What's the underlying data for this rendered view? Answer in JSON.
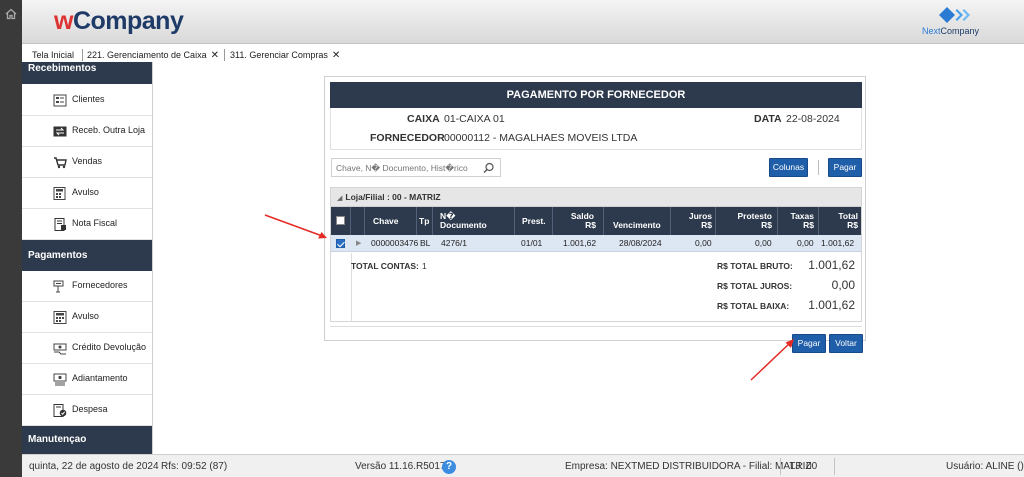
{
  "app": {
    "brand_w": "w",
    "brand_rest": "Company",
    "partner_prefix": "Next",
    "partner_suffix": "Company"
  },
  "tabs": [
    {
      "label": "Tela Inicial"
    },
    {
      "label": "221. Gerenciamento de Caixa"
    },
    {
      "label": "311. Gerenciar Compras"
    }
  ],
  "sidebar": {
    "sections": {
      "recebimentos": "Recebimentos",
      "pagamentos": "Pagamentos",
      "manutencao": "Manutençao"
    },
    "receb_items": [
      {
        "label": "Clientes",
        "icon": "users-list-icon"
      },
      {
        "label": "Receb. Outra Loja",
        "icon": "transfer-icon"
      },
      {
        "label": "Vendas",
        "icon": "cart-icon"
      },
      {
        "label": "Avulso",
        "icon": "calculator-icon"
      },
      {
        "label": "Nota Fiscal",
        "icon": "invoice-icon"
      }
    ],
    "pag_items": [
      {
        "label": "Fornecedores",
        "icon": "supplier-icon"
      },
      {
        "label": "Avulso",
        "icon": "calculator-icon"
      },
      {
        "label": "Crédito Devolução",
        "icon": "credit-icon"
      },
      {
        "label": "Adiantamento",
        "icon": "advance-icon"
      },
      {
        "label": "Despesa",
        "icon": "expense-icon"
      }
    ]
  },
  "panel": {
    "title": "PAGAMENTO POR FORNECEDOR",
    "caixa_label": "CAIXA",
    "caixa_value": "01-CAIXA 01",
    "data_label": "DATA",
    "data_value": "22-08-2024",
    "fornecedor_label": "FORNECEDOR",
    "fornecedor_value": "00000112 - MAGALHAES MOVEIS LTDA",
    "search_placeholder": "Chave, N� Documento, Hist�rico",
    "colunas_label": "Colunas",
    "pagar_top_label": "Pagar",
    "group_label": "Loja/Filial : 00 - MATRIZ",
    "columns": {
      "chave": "Chave",
      "tp": "Tp",
      "doc_1": "N�",
      "doc_2": "Documento",
      "prest": "Prest.",
      "saldo_1": "Saldo",
      "saldo_2": "R$",
      "venc": "Vencimento",
      "juros_1": "Juros",
      "juros_2": "R$",
      "protesto_1": "Protesto",
      "protesto_2": "R$",
      "taxas_1": "Taxas",
      "taxas_2": "R$",
      "total_1": "Total",
      "total_2": "R$"
    },
    "row": {
      "checked": true,
      "chave": "0000003476",
      "tp": "BL",
      "documento": "4276/1",
      "prest": "01/01",
      "saldo": "1.001,62",
      "vencimento": "28/08/2024",
      "juros": "0,00",
      "protesto": "0,00",
      "taxas": "0,00",
      "total": "1.001,62"
    },
    "totals": {
      "contas_label": "TOTAL CONTAS:",
      "contas_value": "1",
      "bruto_label": "R$ TOTAL BRUTO:",
      "bruto_value": "1.001,62",
      "juros_label": "R$ TOTAL JUROS:",
      "juros_value": "0,00",
      "baixa_label": "R$ TOTAL BAIXA:",
      "baixa_value": "1.001,62"
    },
    "pagar_label": "Pagar",
    "voltar_label": "Voltar"
  },
  "status": {
    "date": "quinta, 22 de agosto de 2024",
    "rfs": "Rfs: 09:52 (87)",
    "version": "Versão 11.16.R5017",
    "help": "?",
    "empresa": "Empresa: NEXTMED DISTRIBUIDORA - Filial: MATRIZ",
    "loja": "LJ: 00",
    "usuario": "Usuário: ALINE ()"
  },
  "colors": {
    "dark_header": "#2d3a4d",
    "button_blue": "#1f5ea8",
    "row_selected": "#dde6f3",
    "annotation_red": "#e32b24"
  }
}
